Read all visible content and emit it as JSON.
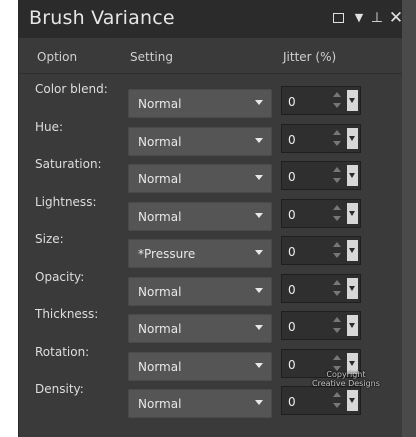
{
  "panel": {
    "title": "Brush Variance"
  },
  "columns": {
    "option": "Option",
    "setting": "Setting",
    "jitter": "Jitter (%)"
  },
  "rows": [
    {
      "label": "Color blend:",
      "setting": "Normal",
      "jitter": "0"
    },
    {
      "label": "Hue:",
      "setting": "Normal",
      "jitter": "0"
    },
    {
      "label": "Saturation:",
      "setting": "Normal",
      "jitter": "0"
    },
    {
      "label": "Lightness:",
      "setting": "Normal",
      "jitter": "0"
    },
    {
      "label": "Size:",
      "setting": "*Pressure",
      "jitter": "0"
    },
    {
      "label": "Opacity:",
      "setting": "Normal",
      "jitter": "0"
    },
    {
      "label": "Thickness:",
      "setting": "Normal",
      "jitter": "0"
    },
    {
      "label": "Rotation:",
      "setting": "Normal",
      "jitter": "0"
    },
    {
      "label": "Density:",
      "setting": "Normal",
      "jitter": "0"
    }
  ],
  "watermark": {
    "line1": "Copyright",
    "line2": "Creative Designs"
  },
  "colors": {
    "panel_bg": "#3a3a3a",
    "titlebar_bg": "#2b2b2b",
    "select_bg": "#555555",
    "jitter_bg": "#2f2f2f"
  }
}
